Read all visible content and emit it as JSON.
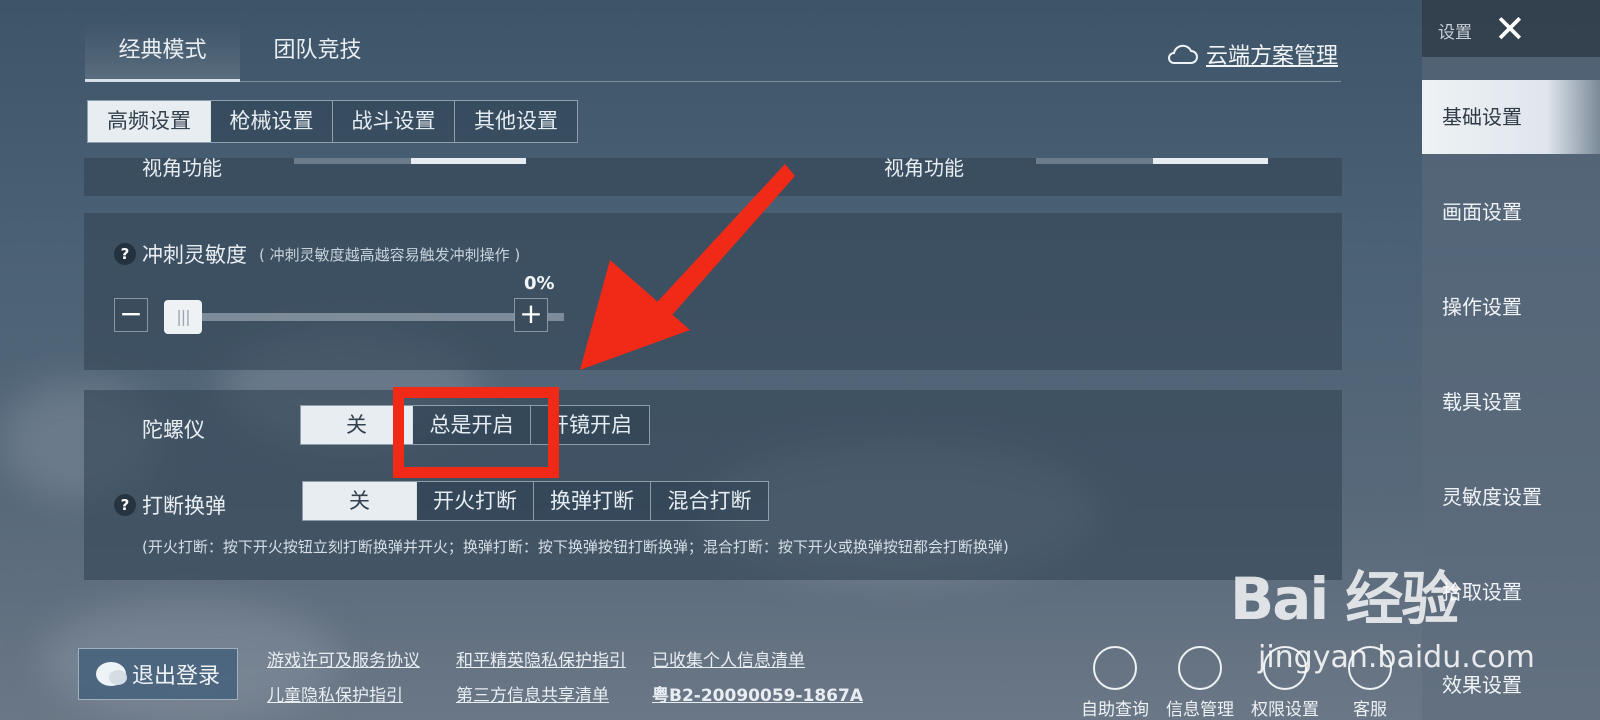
{
  "mode_tabs": [
    "经典模式",
    "团队竞技"
  ],
  "cloud_link": "云端方案管理",
  "sub_tabs": [
    "高频设置",
    "枪械设置",
    "战斗设置",
    "其他设置"
  ],
  "view_labels": [
    "视角功能",
    "视角功能"
  ],
  "sprint": {
    "title": "冲刺灵敏度",
    "desc": "( 冲刺灵敏度越高越容易触发冲刺操作 )",
    "value": "0%",
    "level": 0
  },
  "gyro": {
    "label": "陀螺仪",
    "options": [
      "关",
      "总是开启",
      "开镜开启"
    ],
    "selected": 0
  },
  "reload": {
    "label": "打断换弹",
    "options": [
      "关",
      "开火打断",
      "换弹打断",
      "混合打断"
    ],
    "selected": 0,
    "help": "(开火打断：按下开火按钮立刻打断换弹并开火；换弹打断：按下换弹按钮打断换弹；混合打断：按下开火或换弹按钮都会打断换弹)"
  },
  "footer": {
    "logout": "退出登录",
    "links_row1": [
      "游戏许可及服务协议",
      "和平精英隐私保护指引",
      "已收集个人信息清单"
    ],
    "links_row2": [
      "儿童隐私保护指引",
      "第三方信息共享清单",
      "粤B2-20090059-1867A"
    ],
    "icons": [
      "自助查询",
      "信息管理",
      "权限设置",
      "客服"
    ]
  },
  "sidebar": {
    "title": "设置",
    "items": [
      "基础设置",
      "画面设置",
      "操作设置",
      "载具设置",
      "灵敏度设置",
      "拾取设置",
      "效果设置"
    ]
  },
  "watermark": {
    "brand": "Bai 经验",
    "url": "jingyan.baidu.com"
  },
  "colors": {
    "highlight": "#f02a17",
    "active_tab": "#e8edf1"
  }
}
